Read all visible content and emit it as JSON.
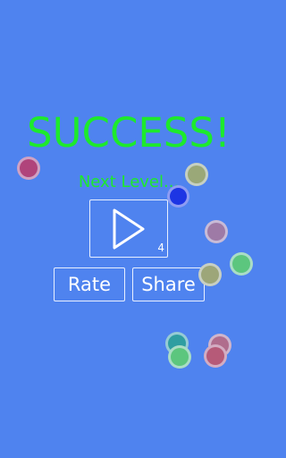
{
  "screen": {
    "title": "SUCCESS!",
    "subtitle": "Next Level...",
    "level_number": "4",
    "rate_label": "Rate",
    "share_label": "Share"
  },
  "colors": {
    "background": "#4f83ef",
    "accent_green": "#1dea2c",
    "button_border": "#e9f0ff",
    "text_white": "#ffffff"
  },
  "icons": {
    "play": "play-triangle-icon"
  },
  "balls": [
    {
      "color": "#b0447b"
    },
    {
      "color": "#9aa878"
    },
    {
      "color": "#1d35e4"
    },
    {
      "color": "#9e7aa6"
    },
    {
      "color": "#5cc67e"
    },
    {
      "color": "#9da679"
    },
    {
      "color": "#2f9ea1"
    },
    {
      "color": "#b06d8d"
    },
    {
      "color": "#5cc67e"
    },
    {
      "color": "#b65a78"
    }
  ]
}
